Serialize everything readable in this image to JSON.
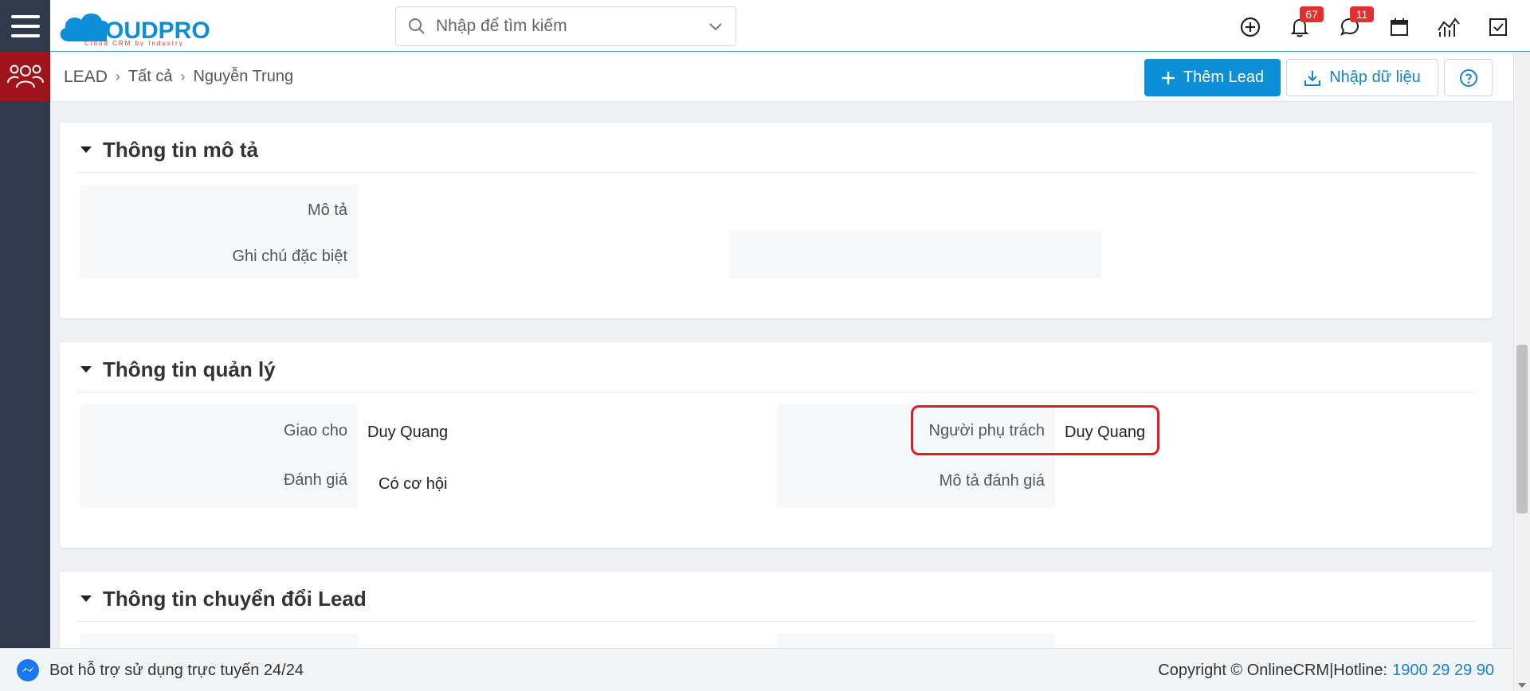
{
  "header": {
    "logo_text": "CLOUDPRO",
    "logo_tagline": "Cloud CRM by Industry",
    "search_placeholder": "Nhập để tìm kiếm",
    "notifications_count": "67",
    "messages_count": "11"
  },
  "breadcrumb": {
    "root": "LEAD",
    "level1": "Tất cả",
    "current": "Nguyễn Trung"
  },
  "toolbar": {
    "add_label": "Thêm Lead",
    "import_label": "Nhập dữ liệu"
  },
  "sections": {
    "description": {
      "title": "Thông tin mô tả",
      "desc_label": "Mô tả",
      "note_label": "Ghi chú đặc biệt"
    },
    "management": {
      "title": "Thông tin quản lý",
      "assigned_label": "Giao cho",
      "assigned_value": "Duy Quang",
      "rating_label": "Đánh giá",
      "rating_value": "Có cơ hội",
      "owner_label": "Người phụ trách",
      "owner_value": "Duy Quang",
      "rating_desc_label": "Mô tả đánh giá"
    },
    "conversion": {
      "title": "Thông tin chuyển đổi Lead"
    }
  },
  "footer": {
    "bot_text": "Bot hỗ trợ sử dụng trực tuyến 24/24",
    "copyright": "Copyright © OnlineCRM|Hotline:",
    "hotline": "1900 29 29 90"
  },
  "colors": {
    "primary": "#0d8fd8",
    "sidebar": "#2f3b4c",
    "sidebar_active": "#a0131a",
    "badge": "#e0302f",
    "highlight": "#e01b24"
  }
}
